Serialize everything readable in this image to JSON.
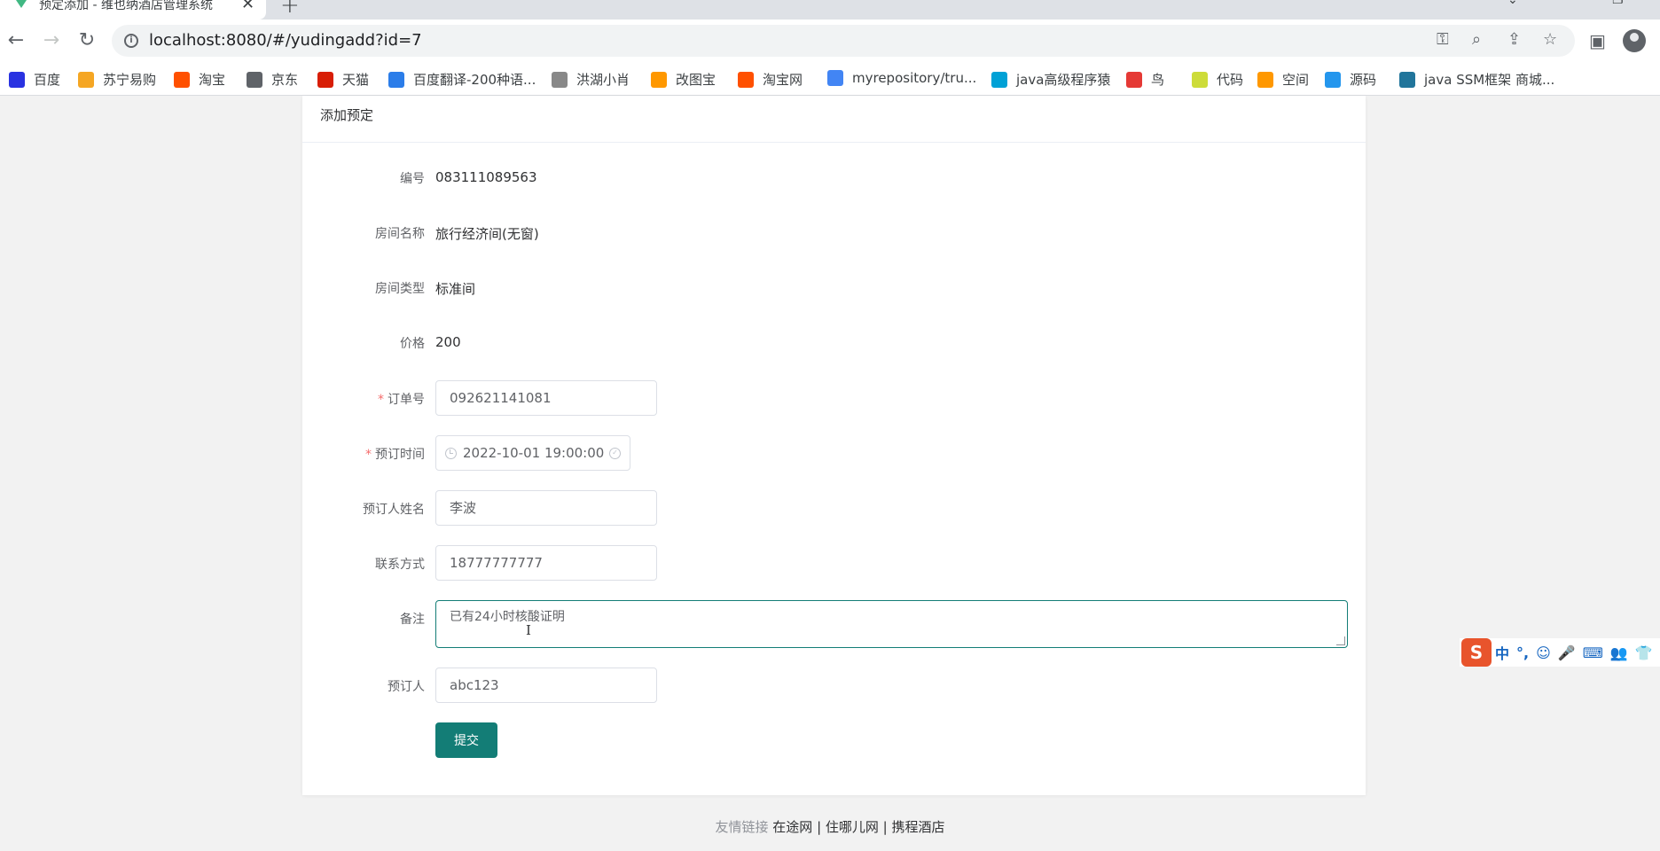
{
  "browser": {
    "tab_title": "预定添加 - 维也纳酒店管理系统",
    "url": "localhost:8080/#/yudingadd?id=7",
    "bookmarks": [
      {
        "label": "百度",
        "icon": "baidu-icon",
        "color": "#2932e1"
      },
      {
        "label": "苏宁易购",
        "icon": "suning-icon",
        "color": "#f5a623"
      },
      {
        "label": "淘宝",
        "icon": "taobao-icon",
        "color": "#ff5000"
      },
      {
        "label": "京东",
        "icon": "globe-icon",
        "color": "#5f6368"
      },
      {
        "label": "天猫",
        "icon": "tmall-icon",
        "color": "#d81e06"
      },
      {
        "label": "百度翻译-200种语...",
        "icon": "translate-icon",
        "color": "#2b7de9"
      },
      {
        "label": "洪湖小肖",
        "icon": "bird-icon",
        "color": "#888888"
      },
      {
        "label": "改图宝",
        "icon": "gaitubao-icon",
        "color": "#ff9800"
      },
      {
        "label": "淘宝网",
        "icon": "taobao-icon",
        "color": "#ff5000"
      },
      {
        "label": "myrepository/tru...",
        "icon": "chrome-icon",
        "color": "#4285f4"
      },
      {
        "label": "java高级程序猿",
        "icon": "bilibili-icon",
        "color": "#00a1d6"
      },
      {
        "label": "鸟",
        "icon": "bird-icon",
        "color": "#e53935"
      },
      {
        "label": "代码",
        "icon": "code-icon",
        "color": "#cddc39"
      },
      {
        "label": "空间",
        "icon": "space-icon",
        "color": "#ff9800"
      },
      {
        "label": "源码",
        "icon": "docker-icon",
        "color": "#2496ed"
      },
      {
        "label": "java SSM框架 商城...",
        "icon": "wordpress-icon",
        "color": "#21759b"
      }
    ]
  },
  "page": {
    "header": "添加预定",
    "fields": {
      "code": {
        "label": "编号",
        "value": "083111089563"
      },
      "room_name": {
        "label": "房间名称",
        "value": "旅行经济间(无窗)"
      },
      "room_type": {
        "label": "房间类型",
        "value": "标准间"
      },
      "price": {
        "label": "价格",
        "value": "200"
      },
      "order_no": {
        "label": "订单号",
        "value": "092621141081",
        "required": true
      },
      "booking_time": {
        "label": "预订时间",
        "value": "2022-10-01 19:00:00",
        "required": true
      },
      "guest_name": {
        "label": "预订人姓名",
        "value": "李波"
      },
      "contact": {
        "label": "联系方式",
        "value": "18777777777"
      },
      "remark": {
        "label": "备注",
        "value": "已有24小时核酸证明"
      },
      "booker": {
        "label": "预订人",
        "value": "abc123"
      }
    },
    "submit_label": "提交",
    "required_mark": "*",
    "footer": {
      "prefix": "友情链接",
      "links": "在途网 | 住哪儿网 | 携程酒店"
    }
  },
  "ime": {
    "logo": "S",
    "items": [
      "中",
      "°,",
      "☺",
      "🎤",
      "⌨",
      "👥",
      "👕"
    ]
  },
  "colors": {
    "primary": "#137d76",
    "required": "#f56c6c"
  }
}
